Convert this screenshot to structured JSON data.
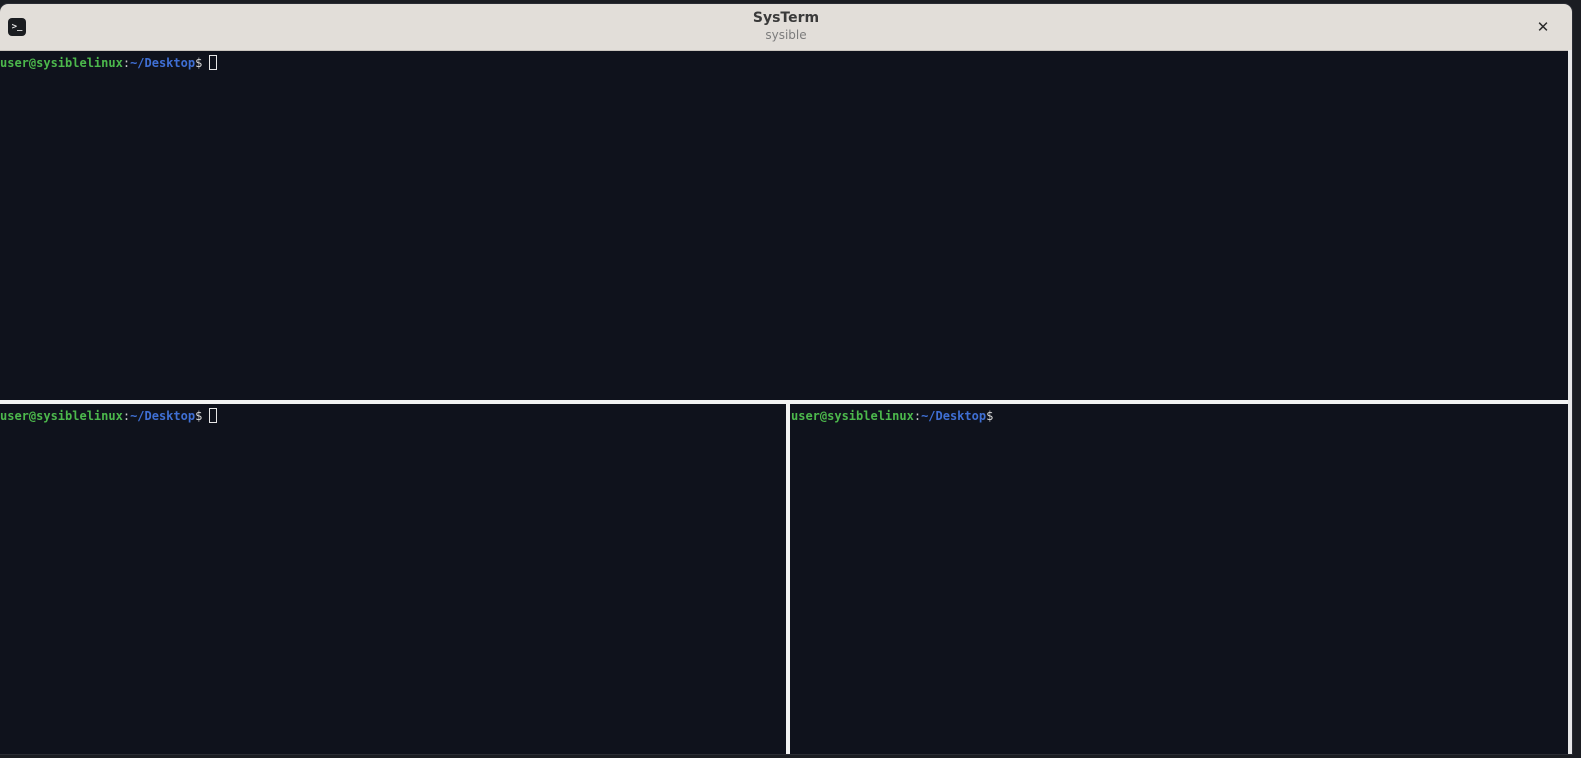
{
  "window": {
    "title": "SysTerm",
    "subtitle": "sysible",
    "app_icon_glyph": ">_",
    "close_glyph": "✕"
  },
  "prompt": {
    "user_host": "user@sysiblelinux",
    "separator": ":",
    "path": "~/Desktop",
    "dollar": "$"
  },
  "panes": [
    {
      "id": "top",
      "has_cursor": true
    },
    {
      "id": "bottom-left",
      "has_cursor": true
    },
    {
      "id": "bottom-right",
      "has_cursor": false
    }
  ],
  "colors": {
    "terminal_bg": "#0f121c",
    "user_host": "#4cb84c",
    "path": "#3f6fd4",
    "titlebar_bg": "#e2ded9",
    "divider": "#f2f2f2"
  }
}
